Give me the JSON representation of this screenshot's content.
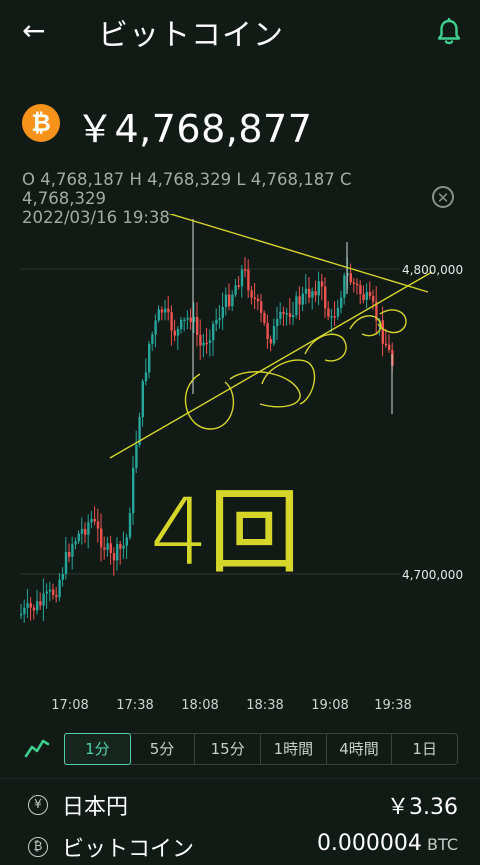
{
  "header": {
    "title": "ビットコイン",
    "back_icon": "←",
    "bell_icon": "bell-icon"
  },
  "ticker": {
    "coin_symbol": "₿",
    "price": "￥4,768,877"
  },
  "ohlc": {
    "text": "O 4,768,187  H 4,768,329  L 4,768,187  C 4,768,329",
    "datetime": "2022/03/16 19:38",
    "close_icon": "⊗"
  },
  "chart_data": {
    "type": "candlestick",
    "y_ticks": [
      "4,800,000",
      "4,700,000"
    ],
    "x_ticks": [
      "17:08",
      "17:38",
      "18:08",
      "18:38",
      "19:08",
      "19:38"
    ],
    "up_color": "#26a69a",
    "down_color": "#ef5350",
    "annotation_text": "4回",
    "annotation_color": "#d6d62a"
  },
  "timeframes": {
    "icon": "line-chart-icon",
    "items": [
      "1分",
      "5分",
      "15分",
      "1時間",
      "4時間",
      "1日"
    ],
    "active_index": 0
  },
  "balances": [
    {
      "icon": "¥",
      "label": "日本円",
      "value": "￥3.36",
      "unit": ""
    },
    {
      "icon": "₿",
      "label": "ビットコイン",
      "value": "0.000004",
      "unit": "BTC"
    }
  ]
}
